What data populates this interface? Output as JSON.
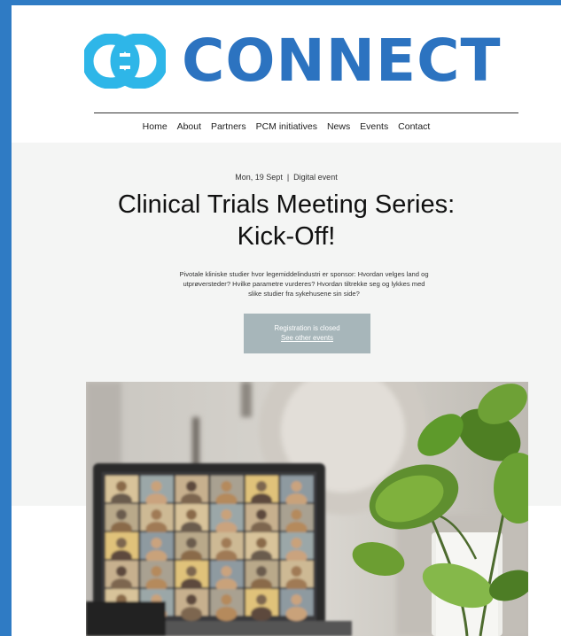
{
  "brand": {
    "logo_text": "CONNECT",
    "logo_icon": "interlinked-rings-logo-icon",
    "colors": {
      "logo_mark": "#2eb6e8",
      "logo_text": "#2c73c0",
      "frame": "#2f7bc4"
    }
  },
  "nav": {
    "items": [
      {
        "label": "Home"
      },
      {
        "label": "About"
      },
      {
        "label": "Partners"
      },
      {
        "label": "PCM initiatives"
      },
      {
        "label": "News"
      },
      {
        "label": "Events"
      },
      {
        "label": "Contact"
      }
    ]
  },
  "event": {
    "date": "Mon, 19 Sept",
    "separator": "|",
    "type": "Digital event",
    "title_line1": "Clinical Trials Meeting Series:",
    "title_line2": "Kick-Off!",
    "description": "Pivotale kliniske studier hvor legemiddelindustri er sponsor: Hvordan velges land og utprøversteder? Hvilke parametre vurderes? Hvordan tiltrekke seg og lykkes med slike studier fra sykehusene sin side?",
    "registration_status": "Registration is closed",
    "other_events_link": "See other events"
  },
  "image": {
    "subject": "laptop-video-conference-with-plant-photo"
  }
}
